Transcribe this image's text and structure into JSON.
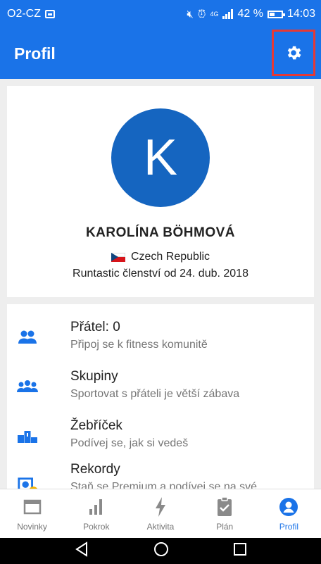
{
  "status_bar": {
    "carrier": "O2-CZ",
    "network": "4G",
    "battery": "42 %",
    "battery_level": 0.42,
    "time": "14:03"
  },
  "app_bar": {
    "title": "Profil",
    "settings_icon": "gear-icon"
  },
  "profile": {
    "initial": "K",
    "name": "KAROLÍNA BÖHMOVÁ",
    "country": "Czech Republic",
    "member_since": "Runtastic členství od 24. dub. 2018"
  },
  "menu": {
    "items": [
      {
        "title": "Přátel: 0",
        "subtitle": "Připoj se k fitness komunitě",
        "icon": "friends-icon"
      },
      {
        "title": "Skupiny",
        "subtitle": "Sportovat s přáteli je větší zábava",
        "icon": "groups-icon"
      },
      {
        "title": "Žebříček",
        "subtitle": "Podívej se, jak si vedeš",
        "icon": "podium-icon"
      },
      {
        "title": "Rekordy",
        "subtitle": "Staň se Premium a podívej se na své",
        "icon": "records-icon"
      }
    ]
  },
  "bottom_nav": {
    "items": [
      {
        "label": "Novinky",
        "icon": "news-icon"
      },
      {
        "label": "Pokrok",
        "icon": "progress-chart-icon"
      },
      {
        "label": "Aktivita",
        "icon": "lightning-icon"
      },
      {
        "label": "Plán",
        "icon": "clipboard-check-icon"
      },
      {
        "label": "Profil",
        "icon": "profile-icon"
      }
    ],
    "active": "Profil"
  },
  "colors": {
    "primary": "#1a73e8",
    "avatar": "#1565c0",
    "highlight": "#e53935",
    "premium_badge": "#f4b400"
  }
}
